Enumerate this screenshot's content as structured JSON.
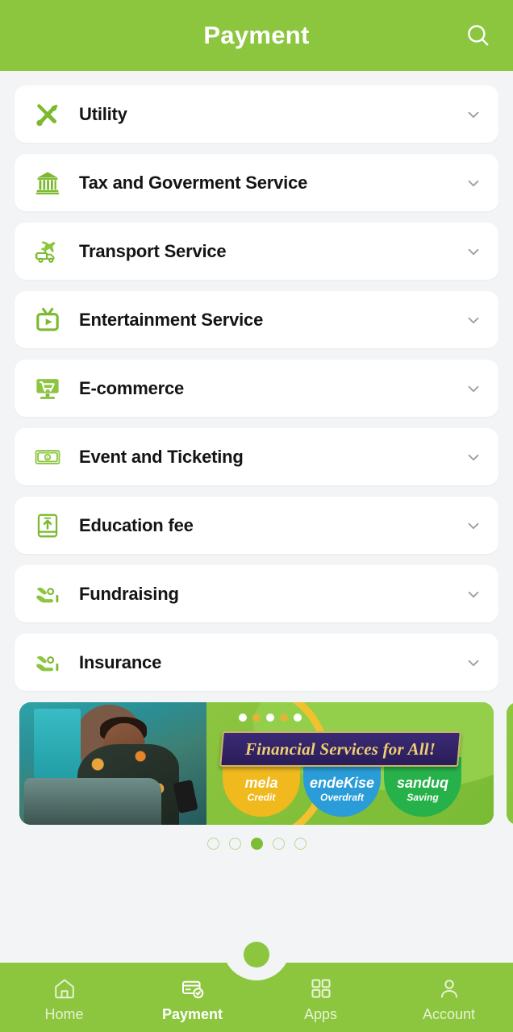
{
  "theme": {
    "brand_green": "#8cc63f",
    "page_bg": "#f2f4f6",
    "card_bg": "#ffffff",
    "text_dark": "#141414",
    "chevron_gray": "#9aa0a6"
  },
  "header": {
    "title": "Payment",
    "search_icon": "search-icon"
  },
  "categories": [
    {
      "label": "Utility",
      "icon": "tools-icon",
      "chevron": "chevron-down-icon"
    },
    {
      "label": "Tax and Goverment Service",
      "icon": "government-building-icon",
      "chevron": "chevron-down-icon"
    },
    {
      "label": "Transport Service",
      "icon": "transport-plane-truck-icon",
      "chevron": "chevron-down-icon"
    },
    {
      "label": "Entertainment Service",
      "icon": "television-icon",
      "chevron": "chevron-down-icon"
    },
    {
      "label": "E-commerce",
      "icon": "monitor-cart-icon",
      "chevron": "chevron-down-icon"
    },
    {
      "label": "Event and Ticketing",
      "icon": "ticket-icon",
      "chevron": "chevron-down-icon"
    },
    {
      "label": "Education fee",
      "icon": "book-upload-icon",
      "chevron": "chevron-down-icon"
    },
    {
      "label": "Fundraising",
      "icon": "hand-coin-icon",
      "chevron": "chevron-down-icon"
    },
    {
      "label": "Insurance",
      "icon": "hand-coin-icon",
      "chevron": "chevron-down-icon"
    }
  ],
  "banner": {
    "headline": "Financial Services for All!",
    "top_dots": [
      "white",
      "gold",
      "white",
      "gold",
      "white"
    ],
    "services": [
      {
        "name": "mela",
        "sub": "Credit",
        "color": "#f0b91e"
      },
      {
        "name": "endeKise",
        "sub": "Overdraft",
        "color": "#2a9cd8"
      },
      {
        "name": "sanduq",
        "sub": "Saving",
        "color": "#27b14a"
      }
    ]
  },
  "pager": {
    "count": 5,
    "active_index": 2
  },
  "bottom_nav": {
    "items": [
      {
        "label": "Home",
        "icon": "home-icon",
        "active": false
      },
      {
        "label": "Payment",
        "icon": "card-check-icon",
        "active": true
      },
      {
        "label": "Apps",
        "icon": "grid-apps-icon",
        "active": false
      },
      {
        "label": "Account",
        "icon": "user-icon",
        "active": false
      }
    ]
  }
}
